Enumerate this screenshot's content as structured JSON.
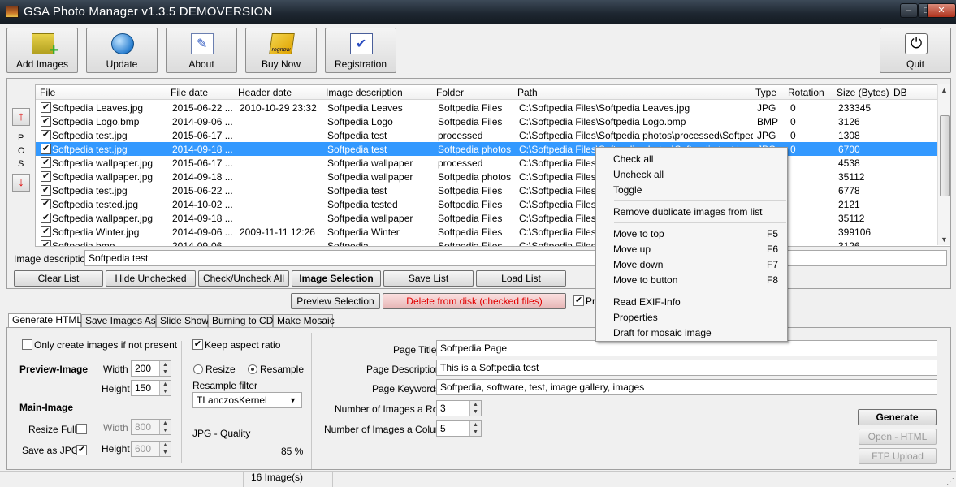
{
  "window": {
    "title": "GSA Photo Manager v1.3.5  DEMOVERSION",
    "minimize": "–",
    "maximize": "□",
    "close": "✕"
  },
  "toolbar": {
    "buttons": [
      {
        "label": "Add Images",
        "icon": "add-images-icon"
      },
      {
        "label": "Update",
        "icon": "globe-icon"
      },
      {
        "label": "About",
        "icon": "document-edit-icon"
      },
      {
        "label": "Buy Now",
        "icon": "regnow-icon"
      },
      {
        "label": "Registration",
        "icon": "checkbox-icon"
      }
    ],
    "quit_label": "Quit"
  },
  "list": {
    "pos_letters": [
      "P",
      "O",
      "S"
    ],
    "columns": [
      "File",
      "File date",
      "Header date",
      "Image description",
      "Folder",
      "Path",
      "Type",
      "Rotation",
      "Size (Bytes)",
      "DB"
    ],
    "rows": [
      {
        "file": "Softpedia Leaves.jpg",
        "file_date": "2015-06-22 ...",
        "header_date": "2010-10-29 23:32",
        "description": "Softpedia Leaves",
        "folder": "Softpedia Files",
        "path": "C:\\Softpedia Files\\Softpedia Leaves.jpg",
        "type": "JPG",
        "rotation": "0",
        "size": "233345",
        "checked": true
      },
      {
        "file": "Softpedia Logo.bmp",
        "file_date": "2014-09-06 ...",
        "header_date": "",
        "description": "Softpedia Logo",
        "folder": "Softpedia Files",
        "path": "C:\\Softpedia Files\\Softpedia Logo.bmp",
        "type": "BMP",
        "rotation": "0",
        "size": "3126",
        "checked": true
      },
      {
        "file": "Softpedia test.jpg",
        "file_date": "2015-06-17 ...",
        "header_date": "",
        "description": "Softpedia test",
        "folder": "processed",
        "path": "C:\\Softpedia Files\\Softpedia photos\\processed\\Softpedi...",
        "type": "JPG",
        "rotation": "0",
        "size": "1308",
        "checked": true
      },
      {
        "file": "Softpedia test.jpg",
        "file_date": "2014-09-18 ...",
        "header_date": "",
        "description": "Softpedia test",
        "folder": "Softpedia photos",
        "path": "C:\\Softpedia Files\\Softpedia photos\\Softpedia test.jpg",
        "type": "JPG",
        "rotation": "0",
        "size": "6700",
        "checked": true,
        "selected": true
      },
      {
        "file": "Softpedia wallpaper.jpg",
        "file_date": "2015-06-17 ...",
        "header_date": "",
        "description": "Softpedia wallpaper",
        "folder": "processed",
        "path": "C:\\Softpedia Files\\S",
        "type": "",
        "rotation": "",
        "size": "4538",
        "checked": true
      },
      {
        "file": "Softpedia wallpaper.jpg",
        "file_date": "2014-09-18 ...",
        "header_date": "",
        "description": "Softpedia wallpaper",
        "folder": "Softpedia photos",
        "path": "C:\\Softpedia Files\\S",
        "type": "",
        "rotation": "",
        "size": "35112",
        "checked": true
      },
      {
        "file": "Softpedia test.jpg",
        "file_date": "2015-06-22 ...",
        "header_date": "",
        "description": "Softpedia test",
        "folder": "Softpedia Files",
        "path": "C:\\Softpedia Files\\S",
        "type": "",
        "rotation": "",
        "size": "6778",
        "checked": true
      },
      {
        "file": "Softpedia tested.jpg",
        "file_date": "2014-10-02 ...",
        "header_date": "",
        "description": "Softpedia tested",
        "folder": "Softpedia Files",
        "path": "C:\\Softpedia Files\\S",
        "type": "",
        "rotation": "",
        "size": "2121",
        "checked": true
      },
      {
        "file": "Softpedia wallpaper.jpg",
        "file_date": "2014-09-18 ...",
        "header_date": "",
        "description": "Softpedia wallpaper",
        "folder": "Softpedia Files",
        "path": "C:\\Softpedia Files\\S",
        "type": "",
        "rotation": "",
        "size": "35112",
        "checked": true
      },
      {
        "file": "Softpedia Winter.jpg",
        "file_date": "2014-09-06 ...",
        "header_date": "2009-11-11 12:26",
        "description": "Softpedia Winter",
        "folder": "Softpedia Files",
        "path": "C:\\Softpedia Files\\S",
        "type": "",
        "rotation": "",
        "size": "399106",
        "checked": true
      },
      {
        "file": "Softpedia.bmp",
        "file_date": "2014-09-06 ...",
        "header_date": "",
        "description": "Softpedia",
        "folder": "Softpedia Files",
        "path": "C:\\Softpedia Files\\S",
        "type": "",
        "rotation": "",
        "size": "3126",
        "checked": true
      }
    ]
  },
  "image_description": {
    "label": "Image description",
    "value": "Softpedia test"
  },
  "action_buttons": {
    "clear_list": "Clear List",
    "hide_unchecked": "Hide Unchecked",
    "check_uncheck_all": "Check/Uncheck All",
    "image_selection": "Image Selection",
    "save_list": "Save List",
    "load_list": "Load List",
    "preview_selection": "Preview Selection",
    "delete_from_disk": "Delete from disk (checked files)",
    "pr_checkbox_label": "Pr"
  },
  "tabs": [
    "Generate HTML",
    "Save Images  As",
    "Slide Show",
    "Burning to CD",
    "Make Mosaic"
  ],
  "html_options": {
    "only_create_label": "Only create images if not present",
    "keep_aspect_label": "Keep aspect ratio",
    "preview_image_label": "Preview-Image",
    "width_label": "Width",
    "height_label": "Height",
    "preview_width": "200",
    "preview_height": "150",
    "resize_label": "Resize",
    "resample_label": "Resample",
    "resample_filter_label": "Resample filter",
    "resample_filter_value": "TLanczosKernel",
    "main_image_label": "Main-Image",
    "resize_full_label": "Resize Fulll",
    "save_as_jpg_label": "Save as JPG",
    "main_width": "800",
    "main_height": "600",
    "jpg_quality_label": "JPG - Quality",
    "jpg_quality_value": "85 %",
    "page_title_label": "Page Title",
    "page_title_value": "Softpedia Page",
    "page_description_label": "Page Description",
    "page_description_value": "This is a Softpedia test",
    "page_keywords_label": "Page Keywords",
    "page_keywords_value": "Softpedia, software, test, image gallery, images",
    "images_row_label": "Number of Images a Row",
    "images_row_value": "3",
    "images_column_label": "Number of Images a Column",
    "images_column_value": "5",
    "generate": "Generate",
    "open_html": "Open - HTML",
    "ftp_upload": "FTP Upload"
  },
  "status": {
    "image_count": "16 Image(s)"
  },
  "context_menu": {
    "items": [
      {
        "label": "Check all",
        "key": ""
      },
      {
        "label": "Uncheck all",
        "key": ""
      },
      {
        "label": "Toggle",
        "key": ""
      },
      {
        "label": "Remove dublicate images from list",
        "key": ""
      },
      {
        "label": "Move to top",
        "key": "F5"
      },
      {
        "label": "Move up",
        "key": "F6"
      },
      {
        "label": "Move down",
        "key": "F7"
      },
      {
        "label": "Move to button",
        "key": "F8"
      },
      {
        "label": "Read EXIF-Info",
        "key": ""
      },
      {
        "label": "Properties",
        "key": ""
      },
      {
        "label": "Draft for mosaic image",
        "key": ""
      }
    ]
  }
}
